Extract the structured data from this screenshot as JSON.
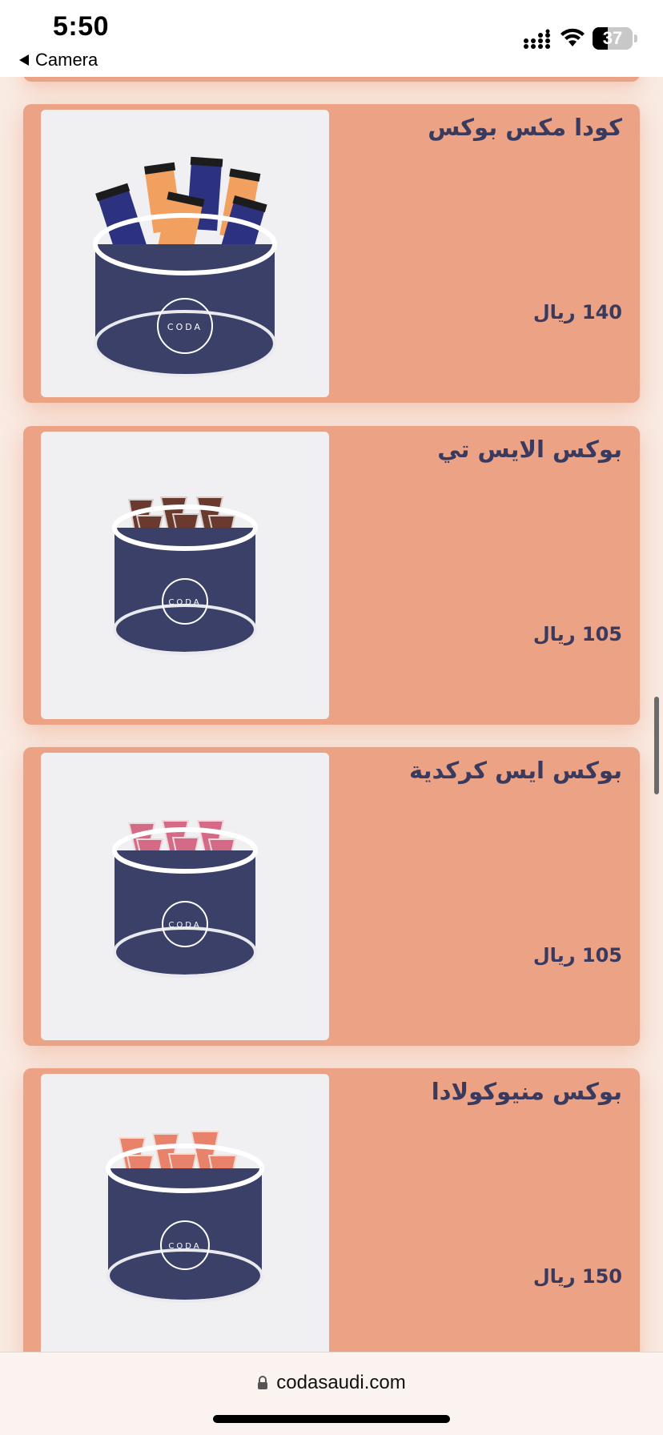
{
  "status_bar": {
    "time": "5:50",
    "back_label": "Camera",
    "battery_level": "37",
    "icons": [
      "back-arrow-icon",
      "cellular-signal-icon",
      "wifi-icon",
      "battery-icon"
    ]
  },
  "products": [
    {
      "title": "كودا مكس بوكس",
      "price": "140 ريال",
      "image_style": "mix",
      "image_brand": "CODA"
    },
    {
      "title": "بوكس الايس تي",
      "price": "105 ريال",
      "image_style": "iced-tea",
      "image_brand": "CODA"
    },
    {
      "title": "بوكس ايس كركدية",
      "price": "105 ريال",
      "image_style": "hibiscus",
      "image_brand": "CODA"
    },
    {
      "title": "بوكس منيوكولادا",
      "price": "150 ريال",
      "image_style": "colada",
      "image_brand": "CODA"
    }
  ],
  "browser": {
    "url": "codasaudi.com",
    "icons": [
      "lock-icon"
    ]
  },
  "colors": {
    "card_background": "#eca385",
    "page_background": "#f9ebe3",
    "text": "#3a3a5e",
    "box_navy": "#3b4068"
  }
}
